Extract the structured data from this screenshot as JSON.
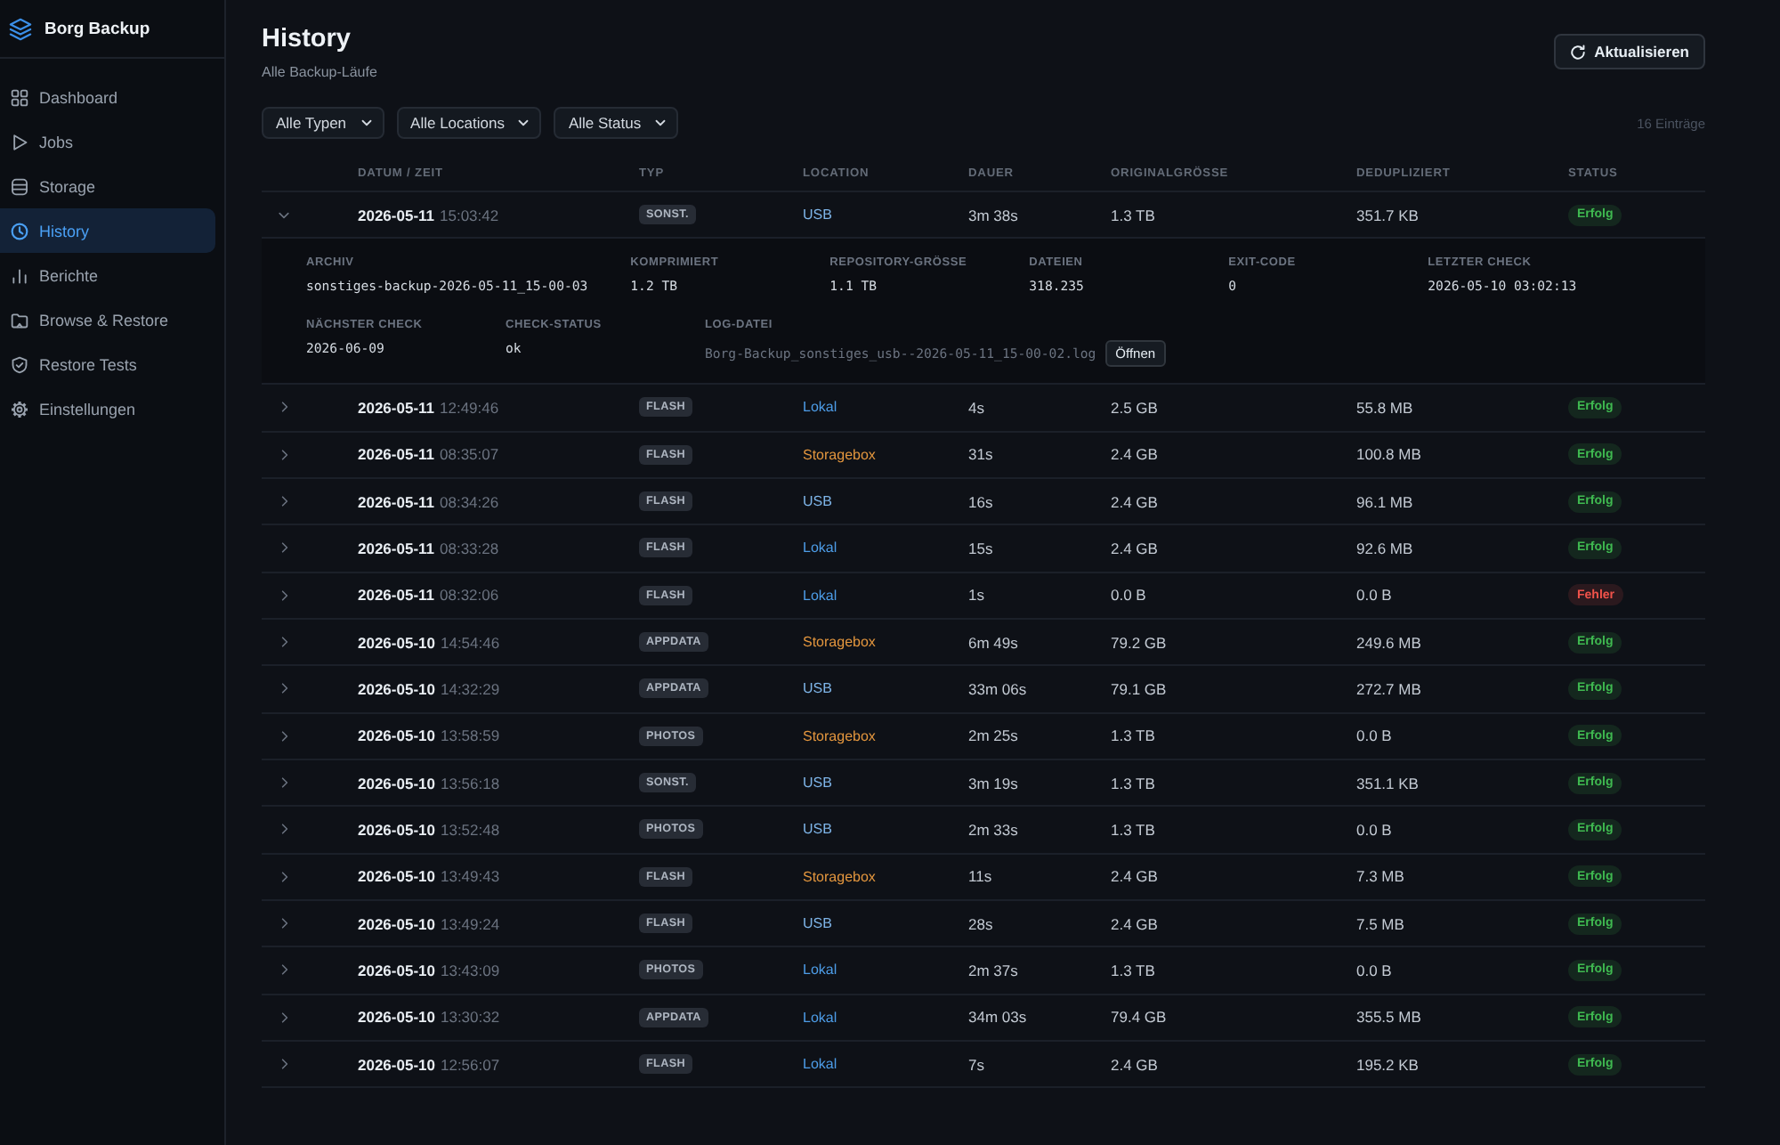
{
  "sidebar": {
    "brand": "Borg Backup",
    "items": [
      {
        "label": "Dashboard",
        "selected": false
      },
      {
        "label": "Jobs",
        "selected": false
      },
      {
        "label": "Storage",
        "selected": false
      },
      {
        "label": "History",
        "selected": true
      },
      {
        "label": "Berichte",
        "selected": false
      },
      {
        "label": "Browse & Restore",
        "selected": false
      },
      {
        "label": "Restore Tests",
        "selected": false
      },
      {
        "label": "Einstellungen",
        "selected": false
      }
    ]
  },
  "header": {
    "title": "History",
    "subtitle": "Alle Backup-Läufe",
    "refresh_button": "Aktualisieren"
  },
  "filters": [
    {
      "label": "Alle Typen"
    },
    {
      "label": "Alle Locations"
    },
    {
      "label": "Alle Status"
    }
  ],
  "entry_count": "16 Einträge",
  "table": {
    "columns": [
      "DATUM / ZEIT",
      "TYP",
      "LOCATION",
      "DAUER",
      "ORIGINALGRÖSSE",
      "DEDUPLIZIERT",
      "STATUS"
    ],
    "rows": [
      {
        "date": "2026-05-11",
        "time": "15:03:42",
        "type": "SONST.",
        "location": {
          "label": "USB",
          "color": "#7fb6ea"
        },
        "duration": "3m 38s",
        "original_size": "1.3 TB",
        "deduplicated": "351.7 KB",
        "status": {
          "label": "Erfolg",
          "color": "#3fb950"
        },
        "expanded": true,
        "details": [
          {
            "kind": "text",
            "label": "ARCHIV",
            "value": "sonstiges-backup-2026-05-11_15-00-03"
          },
          {
            "kind": "text",
            "label": "KOMPRIMIERT",
            "value": "1.2 TB"
          },
          {
            "kind": "text",
            "label": "REPOSITORY-GRÖSSE",
            "value": "1.1 TB"
          },
          {
            "kind": "text",
            "label": "DATEIEN",
            "value": "318.235"
          },
          {
            "kind": "text",
            "label": "EXIT-CODE",
            "value": "0"
          },
          {
            "kind": "text",
            "label": "LETZTER CHECK",
            "value": "2026-05-10 03:02:13"
          },
          {
            "kind": "text",
            "label": "NÄCHSTER CHECK",
            "value": "2026-06-09"
          },
          {
            "kind": "text",
            "label": "CHECK-STATUS",
            "value": "ok"
          },
          {
            "kind": "file",
            "label": "LOG-DATEI",
            "value": "Borg-Backup_sonstiges_usb--2026-05-11_15-00-02.log",
            "button": "Öffnen"
          }
        ]
      },
      {
        "date": "2026-05-11",
        "time": "12:49:46",
        "type": "FLASH",
        "location": {
          "label": "Lokal",
          "color": "#4d9de8"
        },
        "duration": "4s",
        "original_size": "2.5 GB",
        "deduplicated": "55.8 MB",
        "status": {
          "label": "Erfolg",
          "color": "#3fb950"
        },
        "expanded": false
      },
      {
        "date": "2026-05-11",
        "time": "08:35:07",
        "type": "FLASH",
        "location": {
          "label": "Storagebox",
          "color": "#e3963e"
        },
        "duration": "31s",
        "original_size": "2.4 GB",
        "deduplicated": "100.8 MB",
        "status": {
          "label": "Erfolg",
          "color": "#3fb950"
        },
        "expanded": false
      },
      {
        "date": "2026-05-11",
        "time": "08:34:26",
        "type": "FLASH",
        "location": {
          "label": "USB",
          "color": "#7fb6ea"
        },
        "duration": "16s",
        "original_size": "2.4 GB",
        "deduplicated": "96.1 MB",
        "status": {
          "label": "Erfolg",
          "color": "#3fb950"
        },
        "expanded": false
      },
      {
        "date": "2026-05-11",
        "time": "08:33:28",
        "type": "FLASH",
        "location": {
          "label": "Lokal",
          "color": "#4d9de8"
        },
        "duration": "15s",
        "original_size": "2.4 GB",
        "deduplicated": "92.6 MB",
        "status": {
          "label": "Erfolg",
          "color": "#3fb950"
        },
        "expanded": false
      },
      {
        "date": "2026-05-11",
        "time": "08:32:06",
        "type": "FLASH",
        "location": {
          "label": "Lokal",
          "color": "#4d9de8"
        },
        "duration": "1s",
        "original_size": "0.0 B",
        "deduplicated": "0.0 B",
        "status": {
          "label": "Fehler",
          "color": "#f0524a"
        },
        "expanded": false
      },
      {
        "date": "2026-05-10",
        "time": "14:54:46",
        "type": "APPDATA",
        "location": {
          "label": "Storagebox",
          "color": "#e3963e"
        },
        "duration": "6m 49s",
        "original_size": "79.2 GB",
        "deduplicated": "249.6 MB",
        "status": {
          "label": "Erfolg",
          "color": "#3fb950"
        },
        "expanded": false
      },
      {
        "date": "2026-05-10",
        "time": "14:32:29",
        "type": "APPDATA",
        "location": {
          "label": "USB",
          "color": "#7fb6ea"
        },
        "duration": "33m 06s",
        "original_size": "79.1 GB",
        "deduplicated": "272.7 MB",
        "status": {
          "label": "Erfolg",
          "color": "#3fb950"
        },
        "expanded": false
      },
      {
        "date": "2026-05-10",
        "time": "13:58:59",
        "type": "PHOTOS",
        "location": {
          "label": "Storagebox",
          "color": "#e3963e"
        },
        "duration": "2m 25s",
        "original_size": "1.3 TB",
        "deduplicated": "0.0 B",
        "status": {
          "label": "Erfolg",
          "color": "#3fb950"
        },
        "expanded": false
      },
      {
        "date": "2026-05-10",
        "time": "13:56:18",
        "type": "SONST.",
        "location": {
          "label": "USB",
          "color": "#7fb6ea"
        },
        "duration": "3m 19s",
        "original_size": "1.3 TB",
        "deduplicated": "351.1 KB",
        "status": {
          "label": "Erfolg",
          "color": "#3fb950"
        },
        "expanded": false
      },
      {
        "date": "2026-05-10",
        "time": "13:52:48",
        "type": "PHOTOS",
        "location": {
          "label": "USB",
          "color": "#7fb6ea"
        },
        "duration": "2m 33s",
        "original_size": "1.3 TB",
        "deduplicated": "0.0 B",
        "status": {
          "label": "Erfolg",
          "color": "#3fb950"
        },
        "expanded": false
      },
      {
        "date": "2026-05-10",
        "time": "13:49:43",
        "type": "FLASH",
        "location": {
          "label": "Storagebox",
          "color": "#e3963e"
        },
        "duration": "11s",
        "original_size": "2.4 GB",
        "deduplicated": "7.3 MB",
        "status": {
          "label": "Erfolg",
          "color": "#3fb950"
        },
        "expanded": false
      },
      {
        "date": "2026-05-10",
        "time": "13:49:24",
        "type": "FLASH",
        "location": {
          "label": "USB",
          "color": "#7fb6ea"
        },
        "duration": "28s",
        "original_size": "2.4 GB",
        "deduplicated": "7.5 MB",
        "status": {
          "label": "Erfolg",
          "color": "#3fb950"
        },
        "expanded": false
      },
      {
        "date": "2026-05-10",
        "time": "13:43:09",
        "type": "PHOTOS",
        "location": {
          "label": "Lokal",
          "color": "#4d9de8"
        },
        "duration": "2m 37s",
        "original_size": "1.3 TB",
        "deduplicated": "0.0 B",
        "status": {
          "label": "Erfolg",
          "color": "#3fb950"
        },
        "expanded": false
      },
      {
        "date": "2026-05-10",
        "time": "13:30:32",
        "type": "APPDATA",
        "location": {
          "label": "Lokal",
          "color": "#4d9de8"
        },
        "duration": "34m 03s",
        "original_size": "79.4 GB",
        "deduplicated": "355.5 MB",
        "status": {
          "label": "Erfolg",
          "color": "#3fb950"
        },
        "expanded": false
      },
      {
        "date": "2026-05-10",
        "time": "12:56:07",
        "type": "FLASH",
        "location": {
          "label": "Lokal",
          "color": "#4d9de8"
        },
        "duration": "7s",
        "original_size": "2.4 GB",
        "deduplicated": "195.2 KB",
        "status": {
          "label": "Erfolg",
          "color": "#3fb950"
        },
        "expanded": false
      }
    ]
  }
}
